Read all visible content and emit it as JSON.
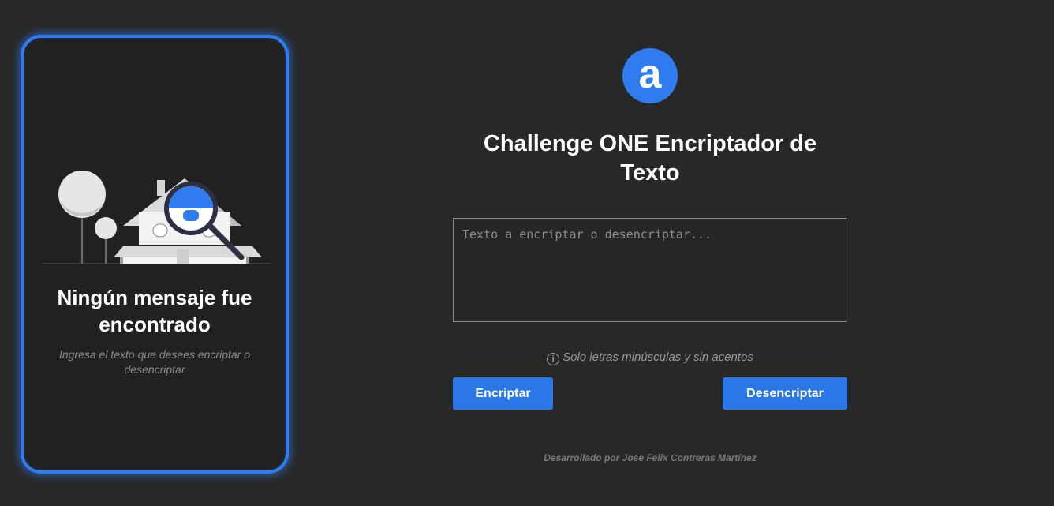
{
  "result_panel": {
    "illustration_icon": "house-magnifier-illustration",
    "title": "Ningún mensaje fue encontrado",
    "subtitle": "Ingresa el texto que desees encriptar o desencriptar"
  },
  "header": {
    "logo_letter": "a",
    "logo_color": "#2f7cf0",
    "title": "Challenge ONE Encriptador de Texto"
  },
  "input": {
    "value": "",
    "placeholder": "Texto a encriptar o desencriptar..."
  },
  "hint": {
    "icon": "info-icon",
    "icon_glyph": "i",
    "text": "Solo letras minúsculas y sin acentos"
  },
  "buttons": {
    "encrypt_label": "Encriptar",
    "decrypt_label": "Desencriptar",
    "color": "#2a77e8"
  },
  "footer": {
    "text": "Desarrollado por Jose Felix Contreras Martínez"
  },
  "colors": {
    "background": "#282828",
    "accent": "#2f7cf0"
  }
}
